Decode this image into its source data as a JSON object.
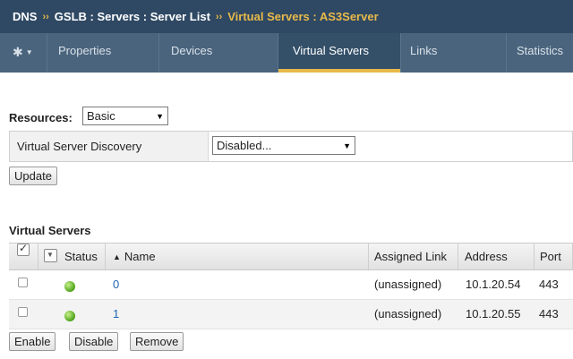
{
  "breadcrumb": {
    "part1": "DNS",
    "part2": "GSLB : Servers : Server List",
    "current": "Virtual Servers : AS3Server",
    "separator": "››"
  },
  "tabs": [
    {
      "label": "Properties"
    },
    {
      "label": "Devices"
    },
    {
      "label": "Virtual Servers",
      "active": true
    },
    {
      "label": "Links"
    },
    {
      "label": "Statistics"
    }
  ],
  "resources": {
    "label": "Resources:",
    "selected": "Basic"
  },
  "discovery": {
    "label": "Virtual Server Discovery",
    "selected": "Disabled..."
  },
  "update_button": "Update",
  "table": {
    "title": "Virtual Servers",
    "columns": [
      "Status",
      "Name",
      "Assigned Link",
      "Address",
      "Port"
    ],
    "rows": [
      {
        "name": "0",
        "assigned_link": "(unassigned)",
        "address": "10.1.20.54",
        "port": "443",
        "status_color": "#4da21a"
      },
      {
        "name": "1",
        "assigned_link": "(unassigned)",
        "address": "10.1.20.55",
        "port": "443",
        "status_color": "#4da21a"
      }
    ]
  },
  "actions": [
    "Enable",
    "Disable",
    "Remove"
  ],
  "colors": {
    "header_bg": "#2f4964",
    "tabbar_bg": "#4a647d",
    "accent": "#e8b94a",
    "link": "#1f64b2"
  }
}
